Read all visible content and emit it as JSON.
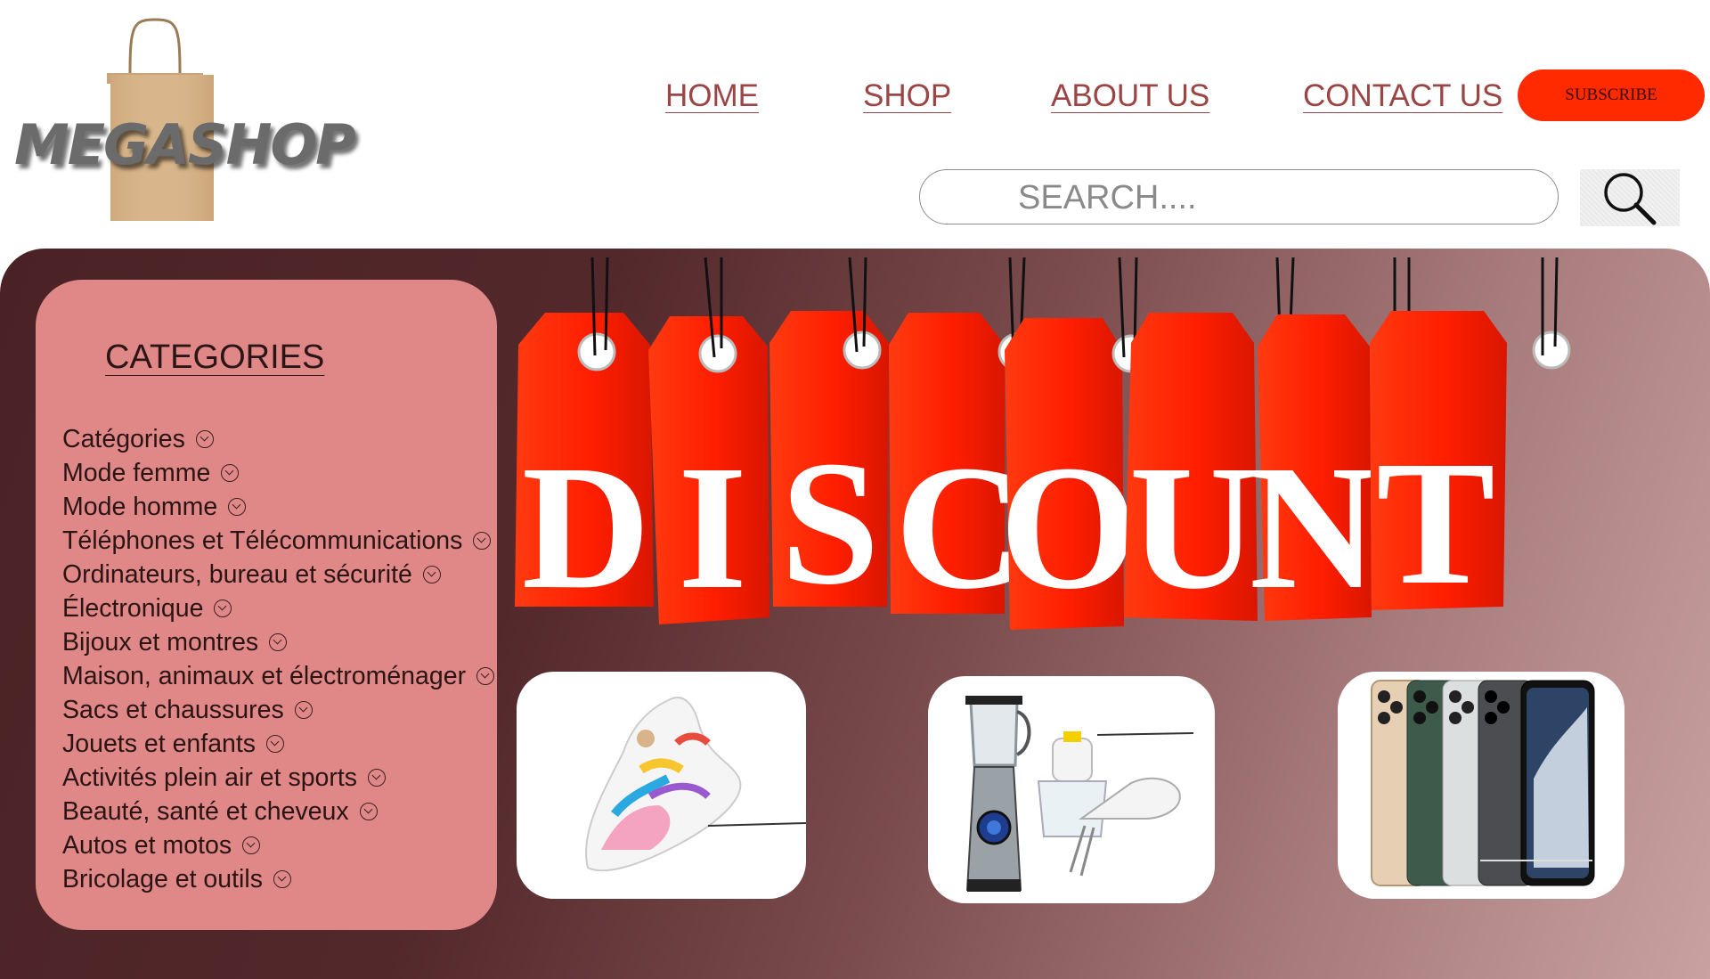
{
  "brand": {
    "name": "MEGASHOP"
  },
  "nav": {
    "items": [
      {
        "label": "HOME"
      },
      {
        "label": "SHOP"
      },
      {
        "label": "ABOUT US"
      },
      {
        "label": "CONTACT US"
      }
    ],
    "subscribe_label": "SUBSCRIBE"
  },
  "search": {
    "placeholder": "SEARCH...."
  },
  "categories": {
    "title": "CATEGORIES",
    "items": [
      "Catégories",
      "Mode femme",
      "Mode homme",
      "Téléphones et Télécommunications",
      "Ordinateurs, bureau et sécurité",
      "Électronique",
      "Bijoux et montres",
      "Maison, animaux et électroménager",
      "Sacs et chaussures",
      "Jouets et enfants",
      "Activités plein air et sports",
      "Beauté, santé et cheveux",
      "Autos et motos",
      "Bricolage et outils"
    ]
  },
  "banner": {
    "letters": [
      "D",
      "I",
      "S",
      "C",
      "O",
      "U",
      "N",
      "T"
    ]
  },
  "products": [
    {
      "icon": "sneaker-icon"
    },
    {
      "icon": "kitchen-appliances-icon"
    },
    {
      "icon": "smartphones-icon"
    }
  ],
  "colors": {
    "accent": "#ff2a00",
    "nav_text": "#9b4545",
    "categories_bg": "#e08888",
    "hero_dark": "#4a2225",
    "hero_light": "#c9a1a1",
    "tag_red": "#ff2200"
  }
}
